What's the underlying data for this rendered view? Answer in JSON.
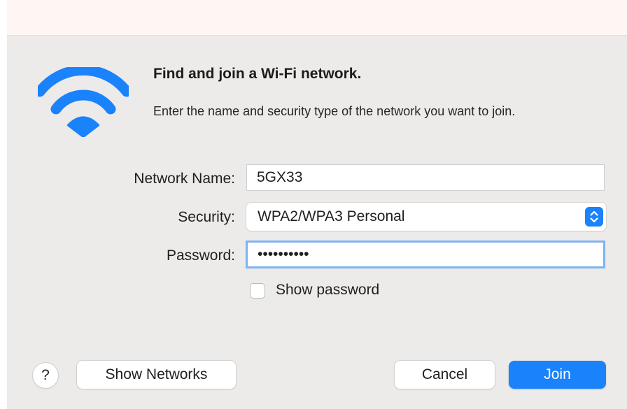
{
  "dialog": {
    "title": "Find and join a Wi-Fi network.",
    "description": "Enter the name and security type of the network you want to join.",
    "icon": "wifi-icon"
  },
  "form": {
    "network_name_label": "Network Name:",
    "network_name_value": "5GX33",
    "security_label": "Security:",
    "security_value": "WPA2/WPA3 Personal",
    "password_label": "Password:",
    "password_value": "••••••••••",
    "show_password_label": "Show password",
    "show_password_checked": false
  },
  "buttons": {
    "help_label": "?",
    "show_networks_label": "Show Networks",
    "cancel_label": "Cancel",
    "join_label": "Join"
  },
  "colors": {
    "accent": "#1a82fb",
    "panel_background": "#ecebea",
    "focus_ring": "#7eb3f2"
  }
}
